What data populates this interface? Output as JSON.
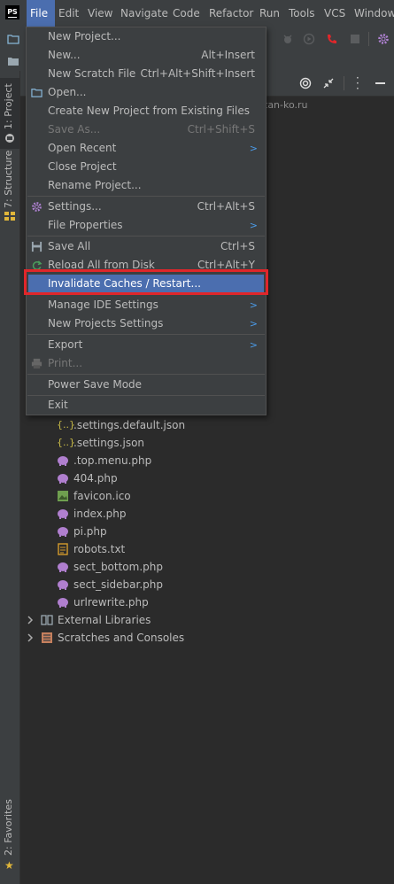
{
  "menubar": {
    "logo_text": "PS",
    "items": [
      "File",
      "Edit",
      "View",
      "Navigate",
      "Code",
      "Refactor",
      "Run",
      "Tools",
      "VCS",
      "Window"
    ]
  },
  "left_stripe": {
    "project_tab": "1: Project",
    "structure_tab": "7: Structure",
    "favorites_tab": "2: Favorites"
  },
  "project_header": {
    "partial_text": "tan-ko.ru"
  },
  "file_menu": {
    "items": [
      {
        "label": "New Project...",
        "shortcut": "",
        "submenu": false,
        "disabled": false,
        "icon": ""
      },
      {
        "label": "New...",
        "shortcut": "Alt+Insert",
        "submenu": false,
        "disabled": false,
        "icon": ""
      },
      {
        "label": "New Scratch File",
        "shortcut": "Ctrl+Alt+Shift+Insert",
        "submenu": false,
        "disabled": false,
        "icon": ""
      },
      {
        "label": "Open...",
        "shortcut": "",
        "submenu": false,
        "disabled": false,
        "icon": "folder-icon"
      },
      {
        "label": "Create New Project from Existing Files",
        "shortcut": "",
        "submenu": false,
        "disabled": false,
        "icon": ""
      },
      {
        "label": "Save As...",
        "shortcut": "Ctrl+Shift+S",
        "submenu": false,
        "disabled": true,
        "icon": ""
      },
      {
        "label": "Open Recent",
        "shortcut": "",
        "submenu": true,
        "disabled": false,
        "icon": ""
      },
      {
        "label": "Close Project",
        "shortcut": "",
        "submenu": false,
        "disabled": false,
        "icon": ""
      },
      {
        "label": "Rename Project...",
        "shortcut": "",
        "submenu": false,
        "disabled": false,
        "icon": ""
      },
      {
        "label": "Settings...",
        "shortcut": "Ctrl+Alt+S",
        "submenu": false,
        "disabled": false,
        "icon": "gear-icon"
      },
      {
        "label": "File Properties",
        "shortcut": "",
        "submenu": true,
        "disabled": false,
        "icon": ""
      },
      {
        "label": "Save All",
        "shortcut": "Ctrl+S",
        "submenu": false,
        "disabled": false,
        "icon": "save-icon"
      },
      {
        "label": "Reload All from Disk",
        "shortcut": "Ctrl+Alt+Y",
        "submenu": false,
        "disabled": false,
        "icon": "reload-icon"
      },
      {
        "label": "Invalidate Caches / Restart...",
        "shortcut": "",
        "submenu": false,
        "disabled": false,
        "icon": "",
        "selected": true
      },
      {
        "label": "Manage IDE Settings",
        "shortcut": "",
        "submenu": true,
        "disabled": false,
        "icon": ""
      },
      {
        "label": "New Projects Settings",
        "shortcut": "",
        "submenu": true,
        "disabled": false,
        "icon": ""
      },
      {
        "label": "Export",
        "shortcut": "",
        "submenu": true,
        "disabled": false,
        "icon": ""
      },
      {
        "label": "Print...",
        "shortcut": "",
        "submenu": false,
        "disabled": true,
        "icon": "printer-icon"
      },
      {
        "label": "Power Save Mode",
        "shortcut": "",
        "submenu": false,
        "disabled": false,
        "icon": ""
      },
      {
        "label": "Exit",
        "shortcut": "",
        "submenu": false,
        "disabled": false,
        "icon": ""
      }
    ]
  },
  "project_tree": {
    "files": [
      {
        "name": ".settings.default.json",
        "icon": "json-icon"
      },
      {
        "name": ".settings.json",
        "icon": "json-icon"
      },
      {
        "name": ".top.menu.php",
        "icon": "php-icon"
      },
      {
        "name": "404.php",
        "icon": "php-icon"
      },
      {
        "name": "favicon.ico",
        "icon": "image-icon"
      },
      {
        "name": "index.php",
        "icon": "php-icon"
      },
      {
        "name": "pi.php",
        "icon": "php-icon"
      },
      {
        "name": "robots.txt",
        "icon": "text-file-icon"
      },
      {
        "name": "sect_bottom.php",
        "icon": "php-icon"
      },
      {
        "name": "sect_sidebar.php",
        "icon": "php-icon"
      },
      {
        "name": "urlrewrite.php",
        "icon": "php-icon"
      }
    ],
    "roots": [
      {
        "name": "External Libraries",
        "icon": "libraries-icon"
      },
      {
        "name": "Scratches and Consoles",
        "icon": "scratches-icon"
      }
    ]
  },
  "colors": {
    "accent": "#4b6eaf",
    "highlight_box": "#e0262a",
    "submenu_arrow": "#4b9be8"
  }
}
